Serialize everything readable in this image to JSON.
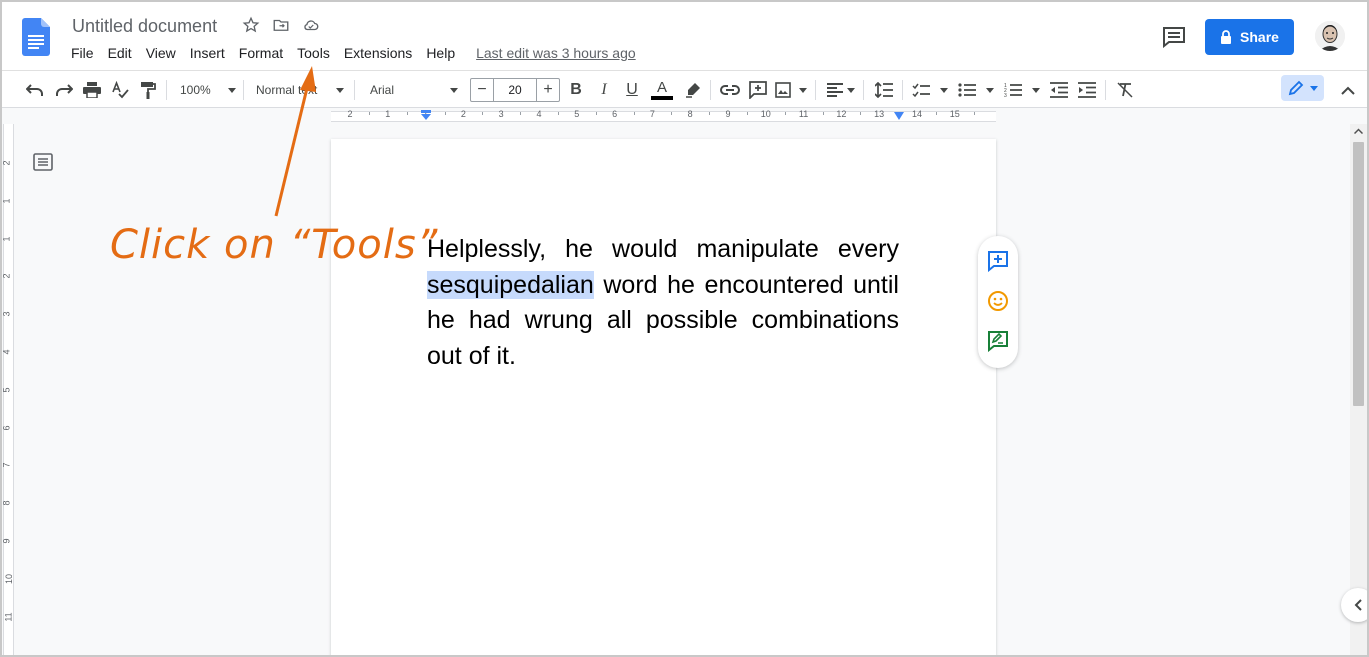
{
  "doc": {
    "title": "Untitled document",
    "last_edit": "Last edit was 3 hours ago"
  },
  "menu": {
    "items": [
      "File",
      "Edit",
      "View",
      "Insert",
      "Format",
      "Tools",
      "Extensions",
      "Help"
    ]
  },
  "share": {
    "label": "Share"
  },
  "toolbar": {
    "zoom": "100%",
    "style": "Normal text",
    "font": "Arial",
    "font_size": "20",
    "minus": "−",
    "plus": "+",
    "bold": "B",
    "italic": "I",
    "underline": "U",
    "text_color_letter": "A"
  },
  "ruler": {
    "labels": [
      "2",
      "1",
      "1",
      "2",
      "3",
      "4",
      "5",
      "6",
      "7",
      "8",
      "9",
      "10",
      "11",
      "12",
      "13",
      "14",
      "15"
    ]
  },
  "vruler": {
    "labels": [
      "2",
      "1",
      "1",
      "2",
      "3",
      "4",
      "5",
      "6",
      "7",
      "8",
      "9",
      "10",
      "11"
    ]
  },
  "body": {
    "before": "Helplessly, he would manipulate every ",
    "highlighted": "sesquipedalian",
    "after": " word he encountered until he had wrung all possible combinations out of it."
  },
  "annotation": {
    "text": "Click on “Tools”",
    "color": "#e46c14"
  },
  "colors": {
    "accent": "#1a73e8",
    "highlight": "#c6dafc",
    "add_comment": "#1a73e8",
    "emoji": "#f29900",
    "suggest": "#188038"
  }
}
